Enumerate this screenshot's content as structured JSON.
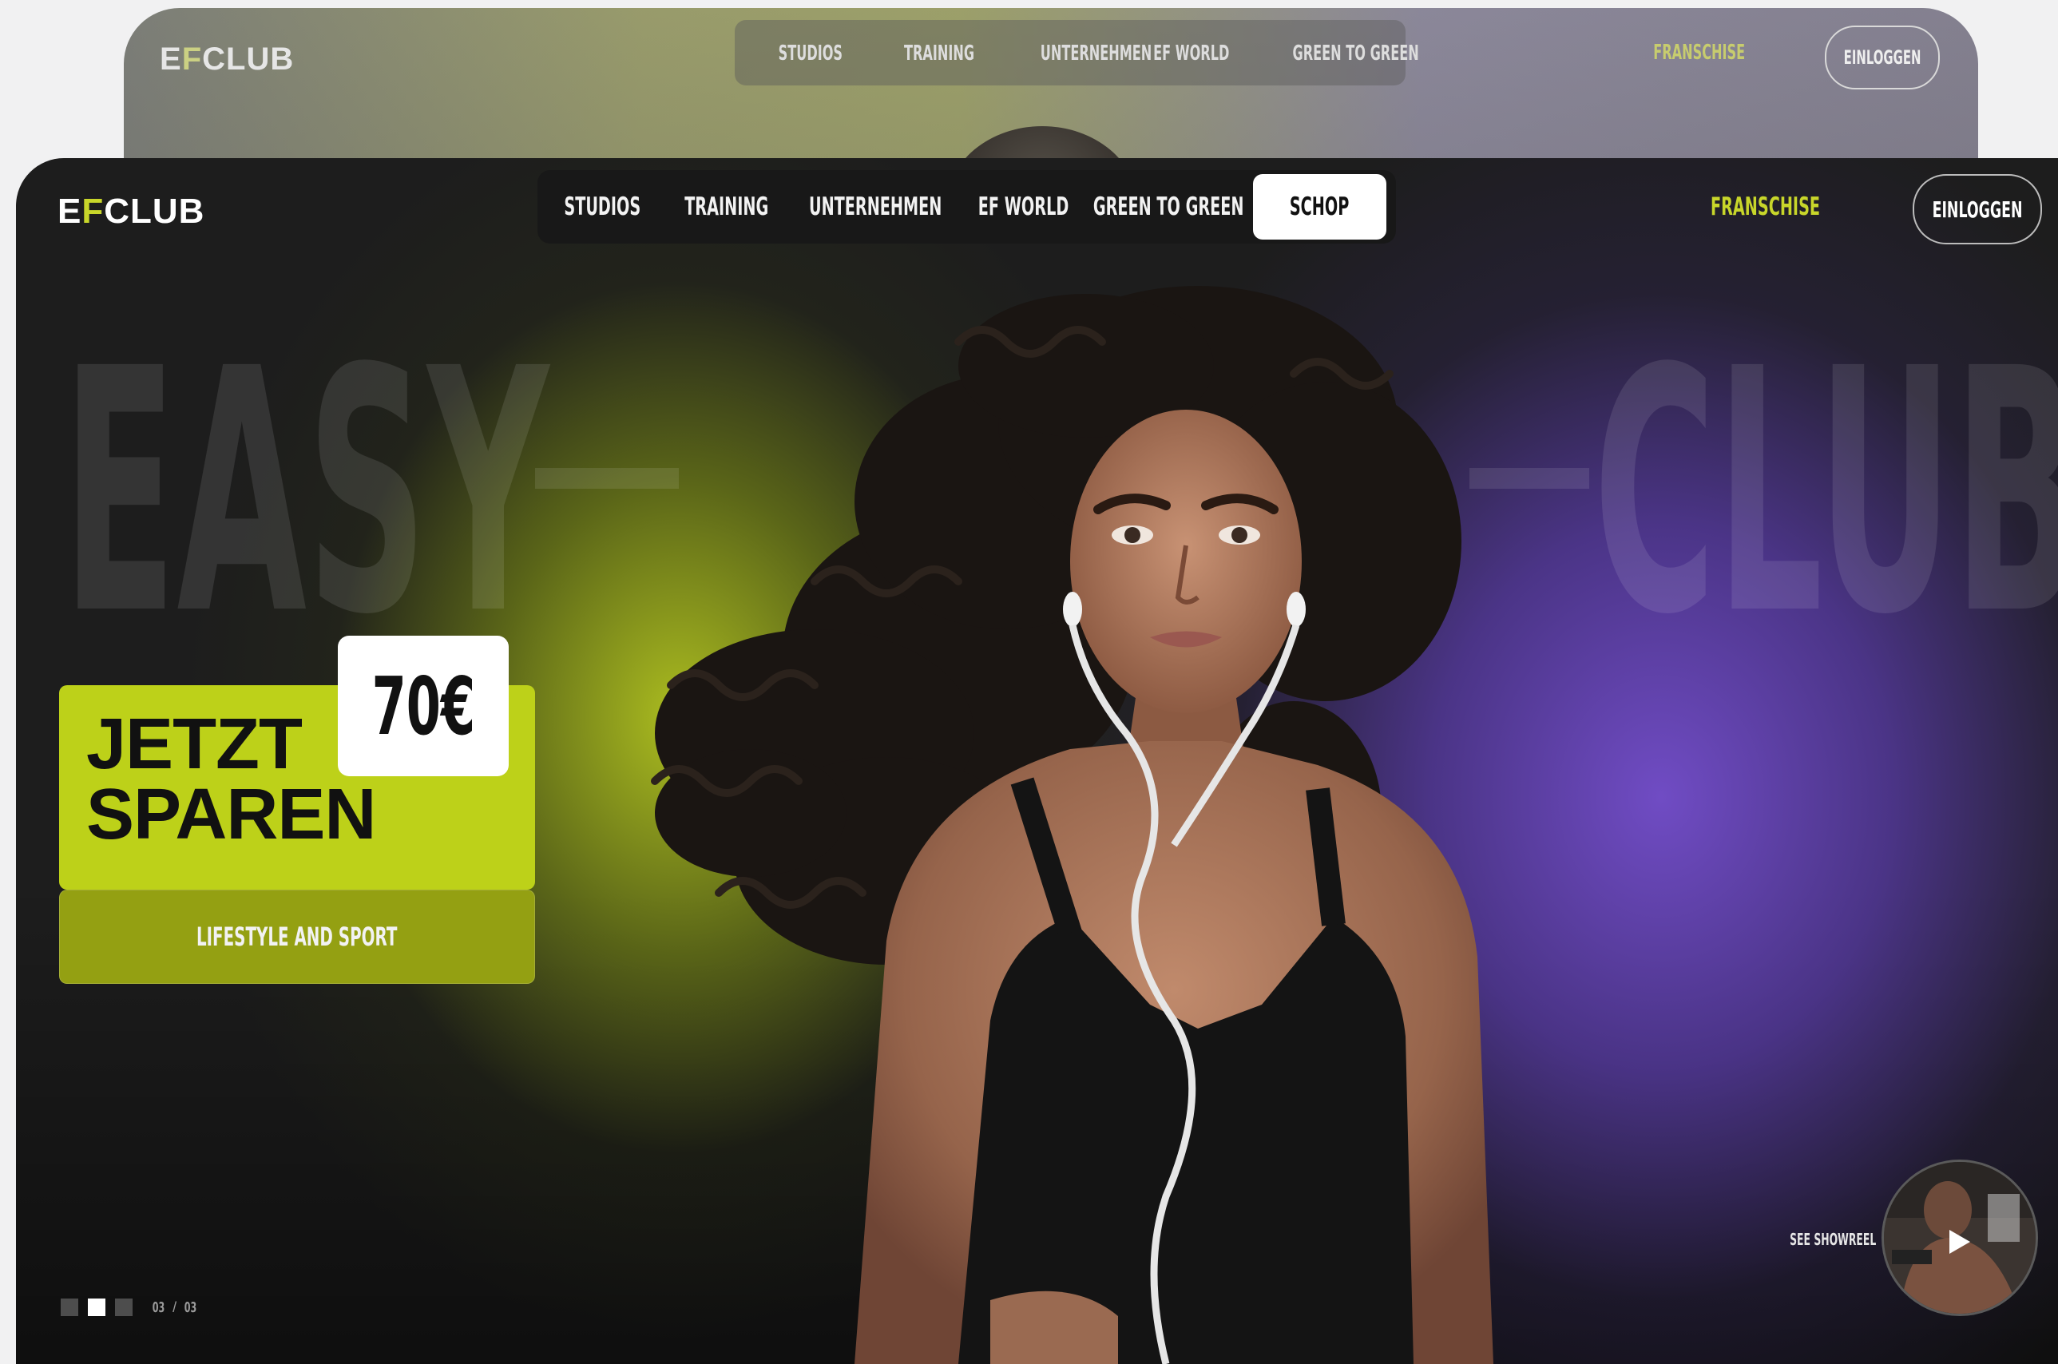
{
  "back_card": {
    "logo": {
      "part1": "E",
      "part2": "F",
      "part3": "CLUB"
    },
    "nav": [
      "STUDIOS",
      "TRAINING",
      "UNTERNEHMEN",
      "EF WORLD",
      "GREEN TO GREEN"
    ],
    "franchise": "FRANSCHISE",
    "login": "EINLOGGEN"
  },
  "header": {
    "logo": {
      "part1": "E",
      "part2": "F",
      "part3": "CLUB"
    },
    "nav": [
      "STUDIOS",
      "TRAINING",
      "UNTERNEHMEN",
      "EF WORLD",
      "GREEN TO GREEN",
      "SCHOP"
    ],
    "active_nav": "SCHOP",
    "franchise": "FRANSCHISE",
    "login": "EINLOGGEN"
  },
  "hero": {
    "background_words": [
      "EASY",
      "CLUB"
    ],
    "promo_line1": "JETZT",
    "promo_line2": "SPAREN",
    "price": "70€",
    "tagline": "LIFESTYLE AND SPORT"
  },
  "pager": {
    "current": "03",
    "separator": "/",
    "total": "03",
    "slides": 3,
    "active_slide": 2
  },
  "showreel": {
    "label": "SEE SHOWREEL",
    "icon": "play-icon"
  },
  "colors": {
    "accent_green": "#bdd119",
    "accent_purple": "#6a4bbd",
    "card_bg": "#1d1d1d"
  }
}
